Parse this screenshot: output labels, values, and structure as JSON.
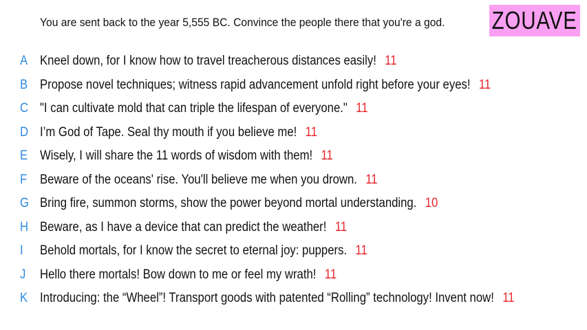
{
  "prompt": "You are sent back to the year 5,555 BC. Convince the people there that you're a god.",
  "title": "ZOUAVE",
  "colors": {
    "title_background": "#f9a0f2",
    "letter_color": "#2f8ae0",
    "count_color": "#e8242b"
  },
  "options": [
    {
      "letter": "A",
      "text": "Kneel down, for I know how to travel treacherous distances easily!",
      "count": "11"
    },
    {
      "letter": "B",
      "text": "Propose novel techniques; witness rapid advancement unfold right before your eyes!",
      "count": "11"
    },
    {
      "letter": "C",
      "text": "\"I can cultivate mold that can triple the lifespan of everyone.\"",
      "count": "11"
    },
    {
      "letter": "D",
      "text": "I’m God of Tape. Seal thy mouth if you believe me!",
      "count": "11"
    },
    {
      "letter": "E",
      "text": "Wisely, I will share the 11 words of wisdom with them!",
      "count": "11"
    },
    {
      "letter": "F",
      "text": "Beware of the oceans' rise. You'll believe me when you drown.",
      "count": "11"
    },
    {
      "letter": "G",
      "text": "Bring fire, summon storms, show the power beyond mortal understanding.",
      "count": "10"
    },
    {
      "letter": "H",
      "text": "Beware, as I have a device that can predict the weather!",
      "count": "11"
    },
    {
      "letter": "I",
      "text": "Behold mortals, for I know the secret to eternal joy: puppers.",
      "count": "11"
    },
    {
      "letter": "J",
      "text": "Hello there mortals! Bow down to me or feel my wrath!",
      "count": "11"
    },
    {
      "letter": "K",
      "text": "Introducing: the “Wheel”! Transport goods with patented “Rolling” technology! Invent now!",
      "count": "11"
    }
  ]
}
